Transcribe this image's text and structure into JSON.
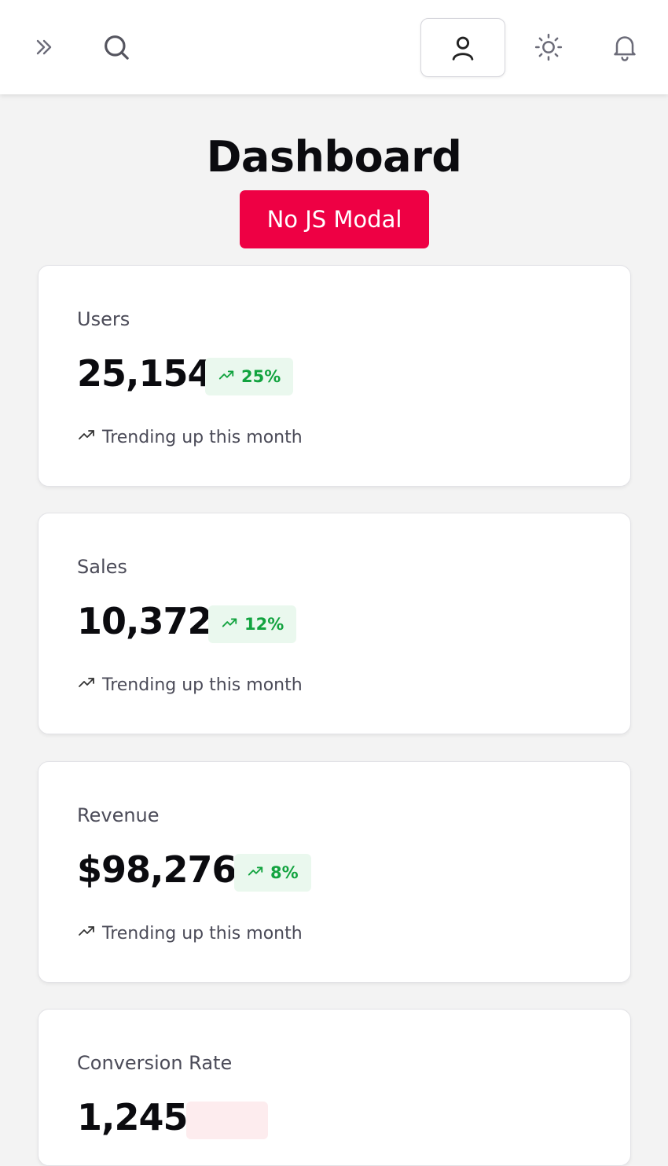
{
  "topbar": {
    "icons": {
      "expand": "chevrons-right-icon",
      "search": "search-icon",
      "user": "user-icon",
      "theme": "sun-icon",
      "notifications": "bell-icon"
    }
  },
  "page": {
    "title": "Dashboard",
    "modal_button": "No JS Modal"
  },
  "cards": [
    {
      "label": "Users",
      "value": "25,154",
      "change": "25%",
      "direction": "up",
      "trend_text": "Trending up this month"
    },
    {
      "label": "Sales",
      "value": "10,372",
      "change": "12%",
      "direction": "up",
      "trend_text": "Trending up this month"
    },
    {
      "label": "Revenue",
      "value": "$98,276",
      "change": "8%",
      "direction": "up",
      "trend_text": "Trending up this month"
    },
    {
      "label": "Conversion Rate",
      "value": "1,245",
      "change": "",
      "direction": "down",
      "trend_text": ""
    }
  ],
  "colors": {
    "accent": "#ee0044",
    "positive": "#12a33f",
    "positive_bg": "#eaf8ee",
    "background": "#f3f3f3"
  }
}
